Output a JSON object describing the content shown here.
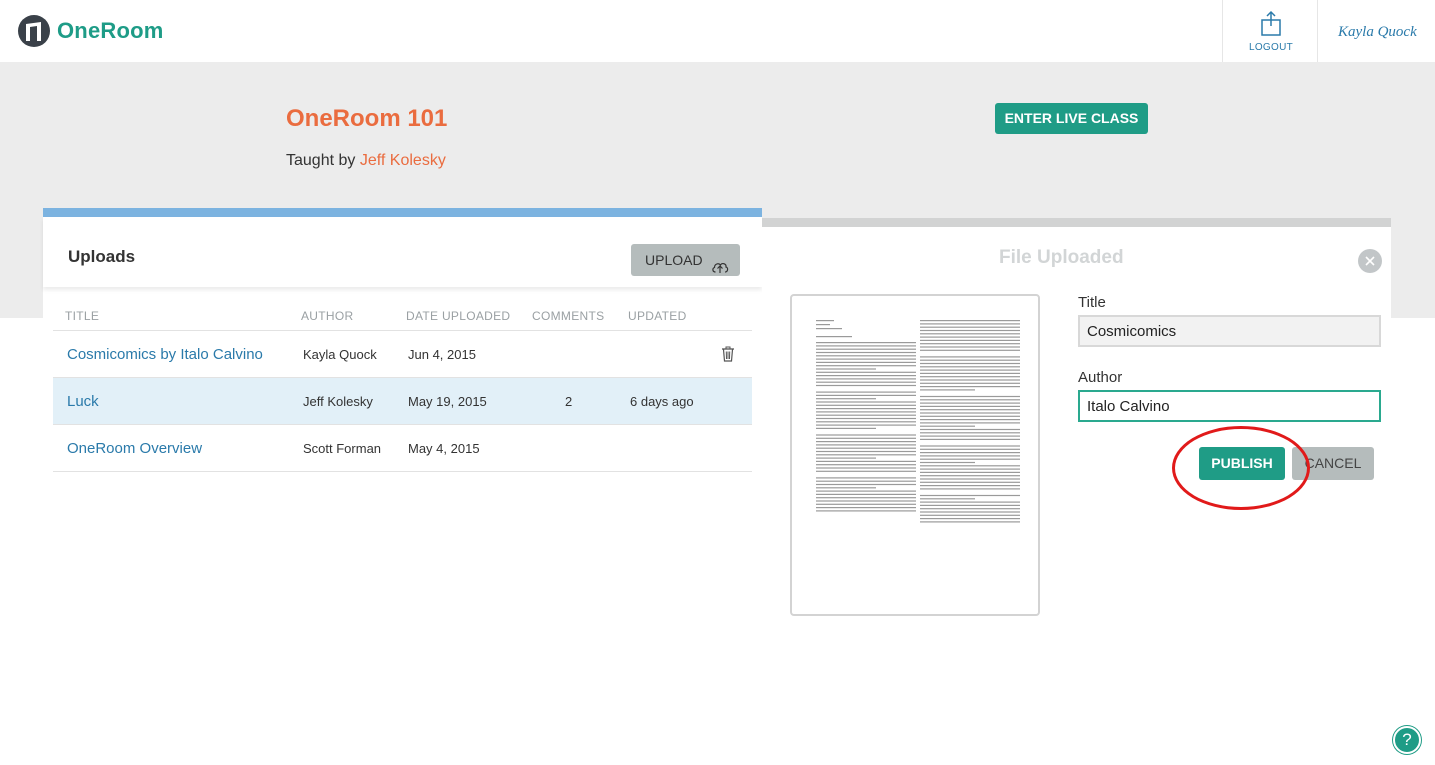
{
  "brand": {
    "name": "OneRoom",
    "logo_icon": "oneroom-logo-icon",
    "color": "#1e9c87"
  },
  "nav": {
    "logout_label": "LOGOUT",
    "logout_icon": "share-upload-icon",
    "user_name": "Kayla Quock"
  },
  "course": {
    "title": "OneRoom 101",
    "taught_by_label": "Taught by",
    "teacher": "Jeff Kolesky",
    "live_button": "ENTER LIVE CLASS"
  },
  "uploads": {
    "heading": "Uploads",
    "upload_button": "UPLOAD",
    "columns": [
      "TITLE",
      "AUTHOR",
      "DATE UPLOADED",
      "COMMENTS",
      "UPDATED"
    ],
    "rows": [
      {
        "title": "Cosmicomics by Italo Calvino",
        "author": "Kayla Quock",
        "date": "Jun 4, 2015",
        "comments": "",
        "updated": "",
        "trash": true,
        "selected": false
      },
      {
        "title": "Luck",
        "author": "Jeff Kolesky",
        "date": "May 19, 2015",
        "comments": "2",
        "updated": "6 days ago",
        "trash": false,
        "selected": true
      },
      {
        "title": "OneRoom Overview",
        "author": "Scott Forman",
        "date": "May 4, 2015",
        "comments": "",
        "updated": "",
        "trash": false,
        "selected": false
      }
    ]
  },
  "dialog": {
    "title": "File Uploaded",
    "title_label": "Title",
    "title_value": "Cosmicomics",
    "author_label": "Author",
    "author_value": "Italo Calvino",
    "publish_button": "PUBLISH",
    "cancel_button": "CANCEL"
  },
  "help": {
    "label": "?"
  },
  "colors": {
    "accent": "#1f9c86",
    "orange": "#ea6c3f",
    "link": "#2a7aaa",
    "uploads_bar": "#7cb3e0",
    "highlight": "#e11a1a"
  }
}
